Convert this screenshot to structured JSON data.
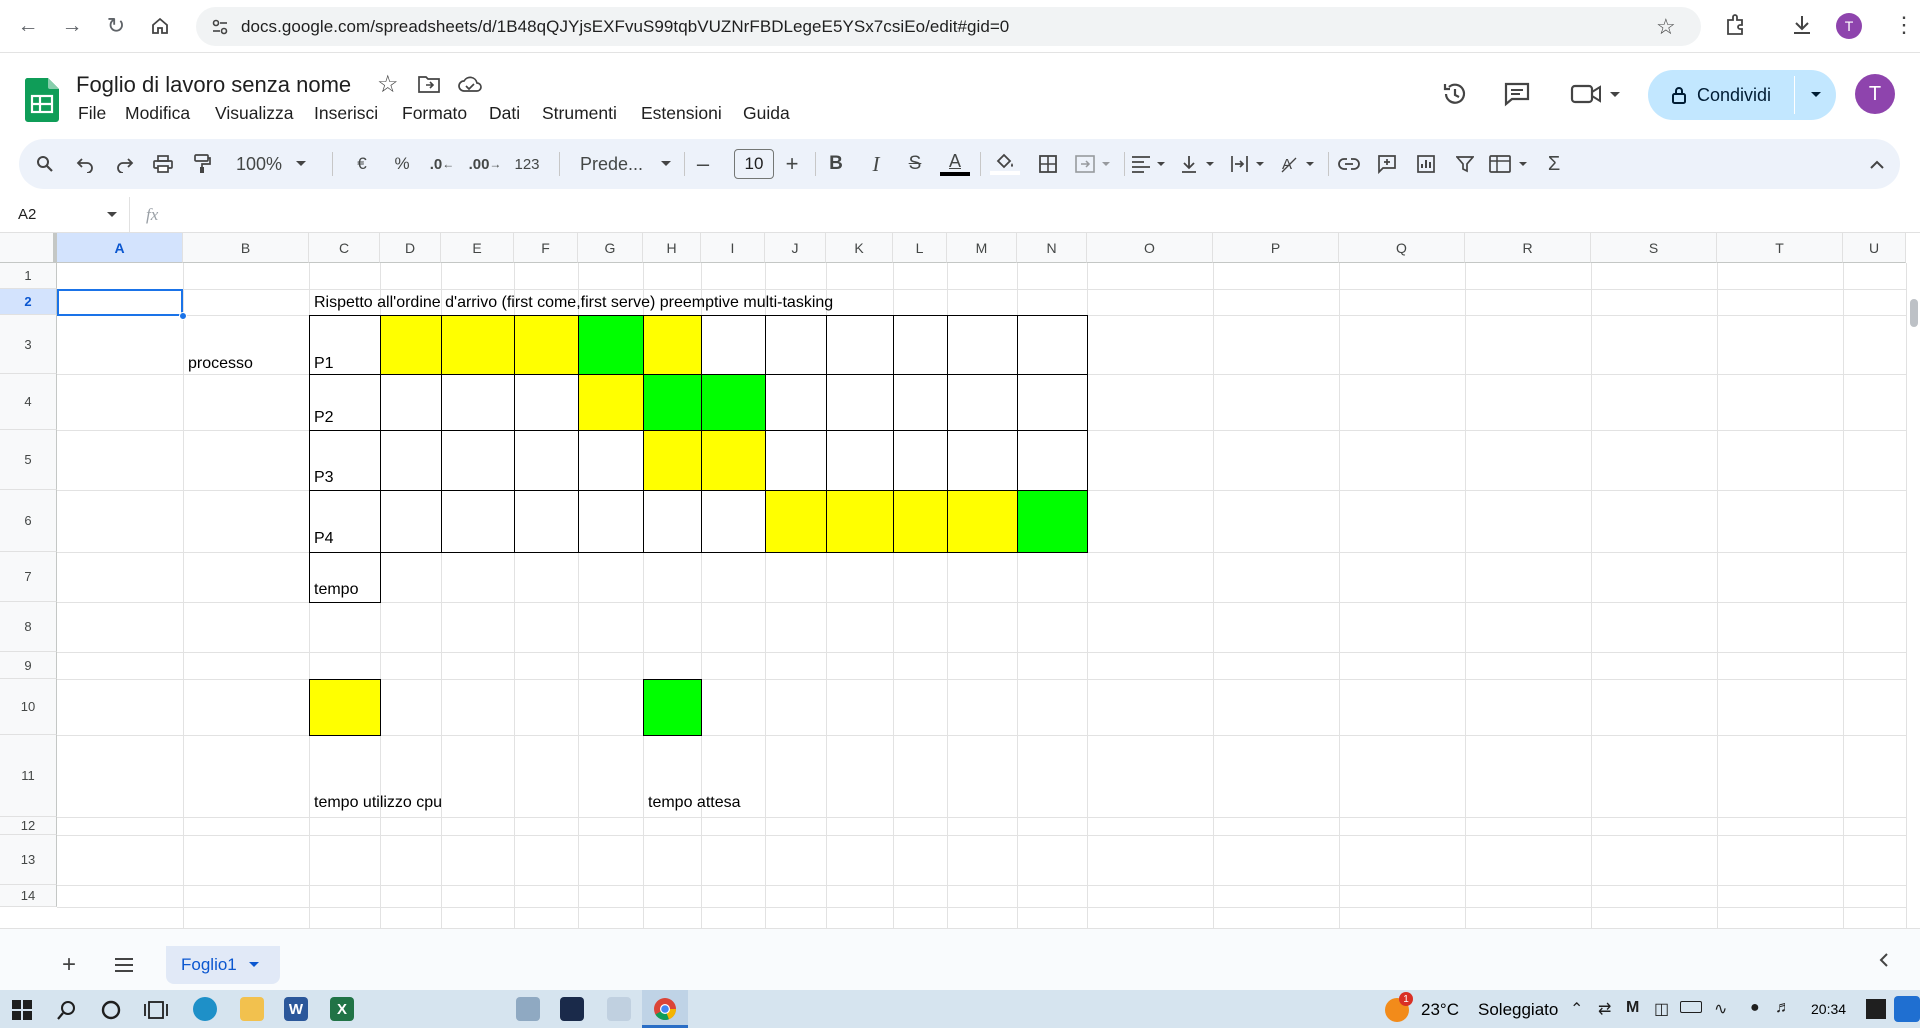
{
  "browser": {
    "url": "docs.google.com/spreadsheets/d/1B48qQJYjsEXFvuS99tqbVUZNrFBDLegeE5YSx7csiEo/edit#gid=0",
    "profile_initial": "T"
  },
  "app": {
    "title": "Foglio di lavoro senza nome",
    "menu": [
      "File",
      "Modifica",
      "Visualizza",
      "Inserisci",
      "Formato",
      "Dati",
      "Strumenti",
      "Estensioni",
      "Guida"
    ],
    "share_label": "Condividi",
    "avatar_initial": "T"
  },
  "toolbar": {
    "zoom": "100%",
    "currency": "€",
    "percent": "%",
    "dec_less": ".0",
    "dec_more": ".00",
    "number_format": "123",
    "font": "Prede...",
    "font_size": "10"
  },
  "formula_bar": {
    "cell_ref": "A2",
    "fx": "fx"
  },
  "columns": [
    "A",
    "B",
    "C",
    "D",
    "E",
    "F",
    "G",
    "H",
    "I",
    "J",
    "K",
    "L",
    "M",
    "N",
    "O",
    "P",
    "Q",
    "R",
    "S",
    "T",
    "U"
  ],
  "rows": [
    "1",
    "2",
    "3",
    "4",
    "5",
    "6",
    "7",
    "8",
    "9",
    "10",
    "11",
    "12",
    "13",
    "14"
  ],
  "cells": {
    "C2": "Rispetto all'ordine d'arrivo (first come,first serve) preemptive multi-tasking",
    "B3": "processo",
    "C3": "P1",
    "C4": "P2",
    "C5": "P3",
    "C6": "P4",
    "C7": "tempo",
    "C11": "tempo utilizzo cpu",
    "H11": "tempo attesa"
  },
  "fill_colors": {
    "yellow": "#ffff00",
    "green": "#00ff00"
  },
  "gantt": {
    "P1": [
      "yellow",
      "yellow",
      "yellow",
      "green",
      "yellow",
      "",
      "",
      "",
      "",
      "",
      ""
    ],
    "P2": [
      "",
      "",
      "",
      "yellow",
      "green",
      "green",
      "",
      "",
      "",
      "",
      ""
    ],
    "P3": [
      "",
      "",
      "",
      "",
      "yellow",
      "yellow",
      "",
      "",
      "",
      "",
      ""
    ],
    "P4": [
      "",
      "",
      "",
      "",
      "",
      "",
      "yellow",
      "yellow",
      "yellow",
      "yellow",
      "green"
    ]
  },
  "sheet_tabs": [
    {
      "label": "Foglio1",
      "active": true
    }
  ],
  "taskbar": {
    "temperature": "23°C",
    "weather": "Soleggiato",
    "weather_badge": "1",
    "time": "20:34"
  },
  "colors": {
    "accent": "#0b57d0",
    "share_bg": "#c2e7ff",
    "toolbar_bg": "#edf2fa",
    "selection": "#1a73e8",
    "sheets_green": "#0f9d58"
  }
}
